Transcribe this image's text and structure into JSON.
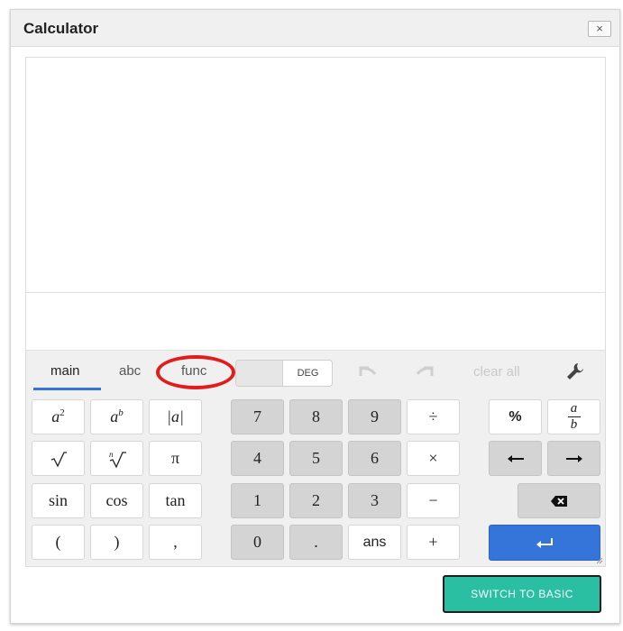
{
  "window": {
    "title": "Calculator",
    "close_label": "×"
  },
  "tabs": [
    {
      "label": "main",
      "active": true
    },
    {
      "label": "abc",
      "active": false
    },
    {
      "label": "func",
      "active": false
    }
  ],
  "angle_mode": {
    "label": "DEG"
  },
  "toolbar": {
    "clear_all_label": "clear all"
  },
  "keys": {
    "abs": "|a|",
    "pi": "π",
    "sin": "sin",
    "cos": "cos",
    "tan": "tan",
    "lparen": "(",
    "rparen": ")",
    "comma": ",",
    "d7": "7",
    "d8": "8",
    "d9": "9",
    "d4": "4",
    "d5": "5",
    "d6": "6",
    "d1": "1",
    "d2": "2",
    "d3": "3",
    "d0": "0",
    "dot": ".",
    "divide": "÷",
    "multiply": "×",
    "minus": "−",
    "plus": "+",
    "ans": "ans",
    "percent": "%",
    "frac_num": "a",
    "frac_den": "b"
  },
  "footer": {
    "switch_label": "SWITCH TO BASIC"
  },
  "colors": {
    "accent_blue": "#3574d8",
    "switch_teal": "#2abfa3",
    "highlight_red": "#e21b1b"
  }
}
